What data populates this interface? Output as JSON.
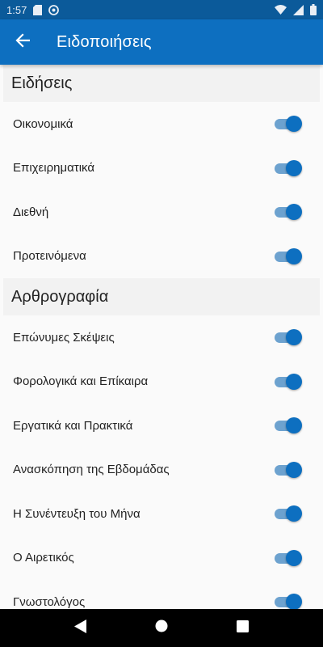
{
  "status_bar": {
    "time": "1:57",
    "left_icons": [
      "sd-card-icon",
      "at-sign-icon"
    ],
    "right_icons": [
      "wifi-icon",
      "signal-icon",
      "battery-icon"
    ]
  },
  "app_bar": {
    "title": "Ειδοποιήσεις",
    "back_icon": "arrow-back-icon",
    "color": "#0d6fc0"
  },
  "sections": [
    {
      "title": "Ειδήσεις",
      "items": [
        {
          "label": "Οικονομικά",
          "enabled": true
        },
        {
          "label": "Επιχειρηματικά",
          "enabled": true
        },
        {
          "label": "Διεθνή",
          "enabled": true
        },
        {
          "label": "Προτεινόμενα",
          "enabled": true
        }
      ]
    },
    {
      "title": "Αρθρογραφία",
      "items": [
        {
          "label": "Επώνυμες Σκέψεις",
          "enabled": true
        },
        {
          "label": "Φορολογικά και Επίκαιρα",
          "enabled": true
        },
        {
          "label": "Εργατικά και Πρακτικά",
          "enabled": true
        },
        {
          "label": "Ανασκόπηση της Εβδομάδας",
          "enabled": true
        },
        {
          "label": "Η Συνέντευξη του Μήνα",
          "enabled": true
        },
        {
          "label": "Ο Αιρετικός",
          "enabled": true
        },
        {
          "label": "Γνωστολόγος",
          "enabled": true
        }
      ]
    }
  ],
  "nav_bar": {
    "buttons": [
      "back-triangle-icon",
      "home-circle-icon",
      "recents-square-icon"
    ]
  }
}
